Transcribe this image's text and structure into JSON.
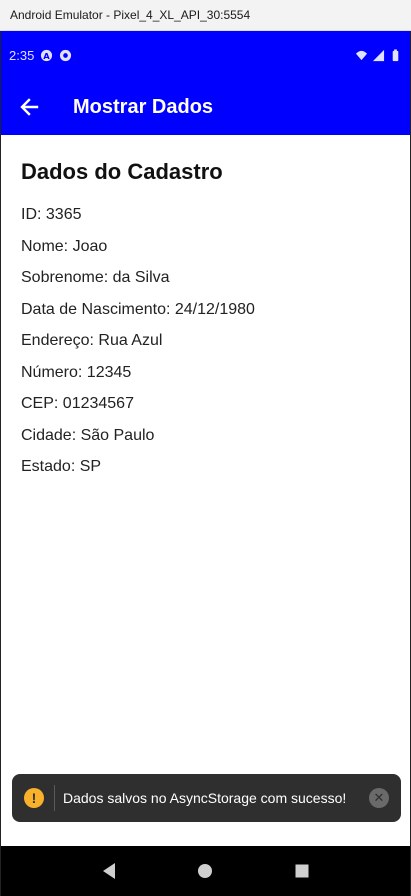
{
  "window": {
    "title": "Android Emulator - Pixel_4_XL_API_30:5554"
  },
  "statusbar": {
    "time": "2:35"
  },
  "appbar": {
    "title": "Mostrar Dados"
  },
  "main": {
    "heading": "Dados do Cadastro",
    "fields": [
      "ID: 3365",
      "Nome: Joao",
      "Sobrenome: da Silva",
      "Data de Nascimento: 24/12/1980",
      "Endereço: Rua Azul",
      "Número: 12345",
      "CEP: 01234567",
      "Cidade: São Paulo",
      "Estado: SP"
    ]
  },
  "toast": {
    "message": "Dados salvos no AsyncStorage com sucesso!"
  },
  "colors": {
    "primary": "#0000ff",
    "toast_bg": "#2f2f2f",
    "warning": "#f9b12b"
  }
}
